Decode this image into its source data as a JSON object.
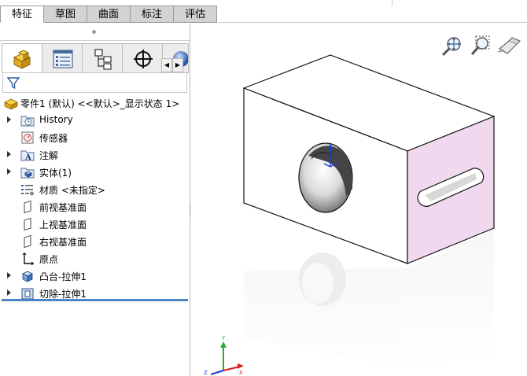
{
  "tabs": [
    "特征",
    "草图",
    "曲面",
    "标注",
    "评估"
  ],
  "active_tab": "特征",
  "manager_tabs": [
    {
      "name": "feature-manager",
      "icon": "feature-manager-icon"
    },
    {
      "name": "property-manager",
      "icon": "property-manager-icon"
    },
    {
      "name": "configuration-manager",
      "icon": "configuration-manager-icon"
    },
    {
      "name": "dimxpert-manager",
      "icon": "crosshair-target-icon"
    },
    {
      "name": "display-manager",
      "icon": "appearance-sphere-icon"
    }
  ],
  "scroll_left": "◀",
  "scroll_right": "▶",
  "tree": {
    "root": "零件1 (默认) <<默认>_显示状态 1>",
    "items": [
      {
        "label": "History",
        "icon": "history-folder-icon",
        "expandable": true
      },
      {
        "label": "传感器",
        "icon": "sensor-icon",
        "expandable": false
      },
      {
        "label": "注解",
        "icon": "annotation-icon",
        "expandable": true
      },
      {
        "label": "实体(1)",
        "icon": "solid-bodies-icon",
        "expandable": true
      },
      {
        "label": "材质 <未指定>",
        "icon": "material-icon",
        "expandable": false
      },
      {
        "label": "前视基准面",
        "icon": "plane-icon",
        "expandable": false
      },
      {
        "label": "上视基准面",
        "icon": "plane-icon",
        "expandable": false
      },
      {
        "label": "右视基准面",
        "icon": "plane-icon",
        "expandable": false
      },
      {
        "label": "原点",
        "icon": "origin-icon",
        "expandable": false
      },
      {
        "label": "凸台-拉伸1",
        "icon": "boss-extrude-icon",
        "expandable": true
      },
      {
        "label": "切除-拉伸1",
        "icon": "cut-extrude-icon",
        "expandable": true
      }
    ]
  },
  "view_tools": [
    "zoom-to-fit-icon",
    "zoom-to-area-icon",
    "previous-view-icon"
  ],
  "colors": {
    "selected_face": "#f0d8ef",
    "rollback_bar": "#4a86c5",
    "tab_bg": "#d3d3d3"
  }
}
